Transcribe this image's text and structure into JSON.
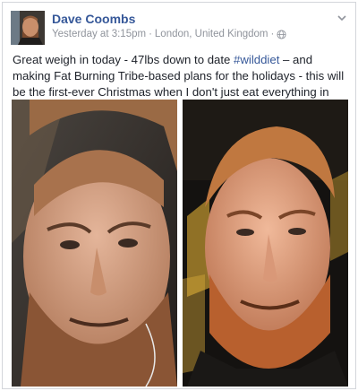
{
  "post": {
    "author": "Dave Coombs",
    "timestamp": "Yesterday at 3:15pm",
    "separator": "·",
    "location": "London, United Kingdom",
    "text_before": "Great weigh in today - 47lbs down to date ",
    "hashtag": "#wilddiet",
    "text_after": " – and making Fat Burning Tribe-based plans for the holidays - this will be the first-ever Christmas when I don't just eat everything in sight and I'm excited about it"
  },
  "icons": {
    "privacy": "globe-icon",
    "options": "chevron-down-icon"
  },
  "colors": {
    "author_link": "#365899",
    "meta_gray": "#90949c",
    "text": "#1d2129"
  }
}
